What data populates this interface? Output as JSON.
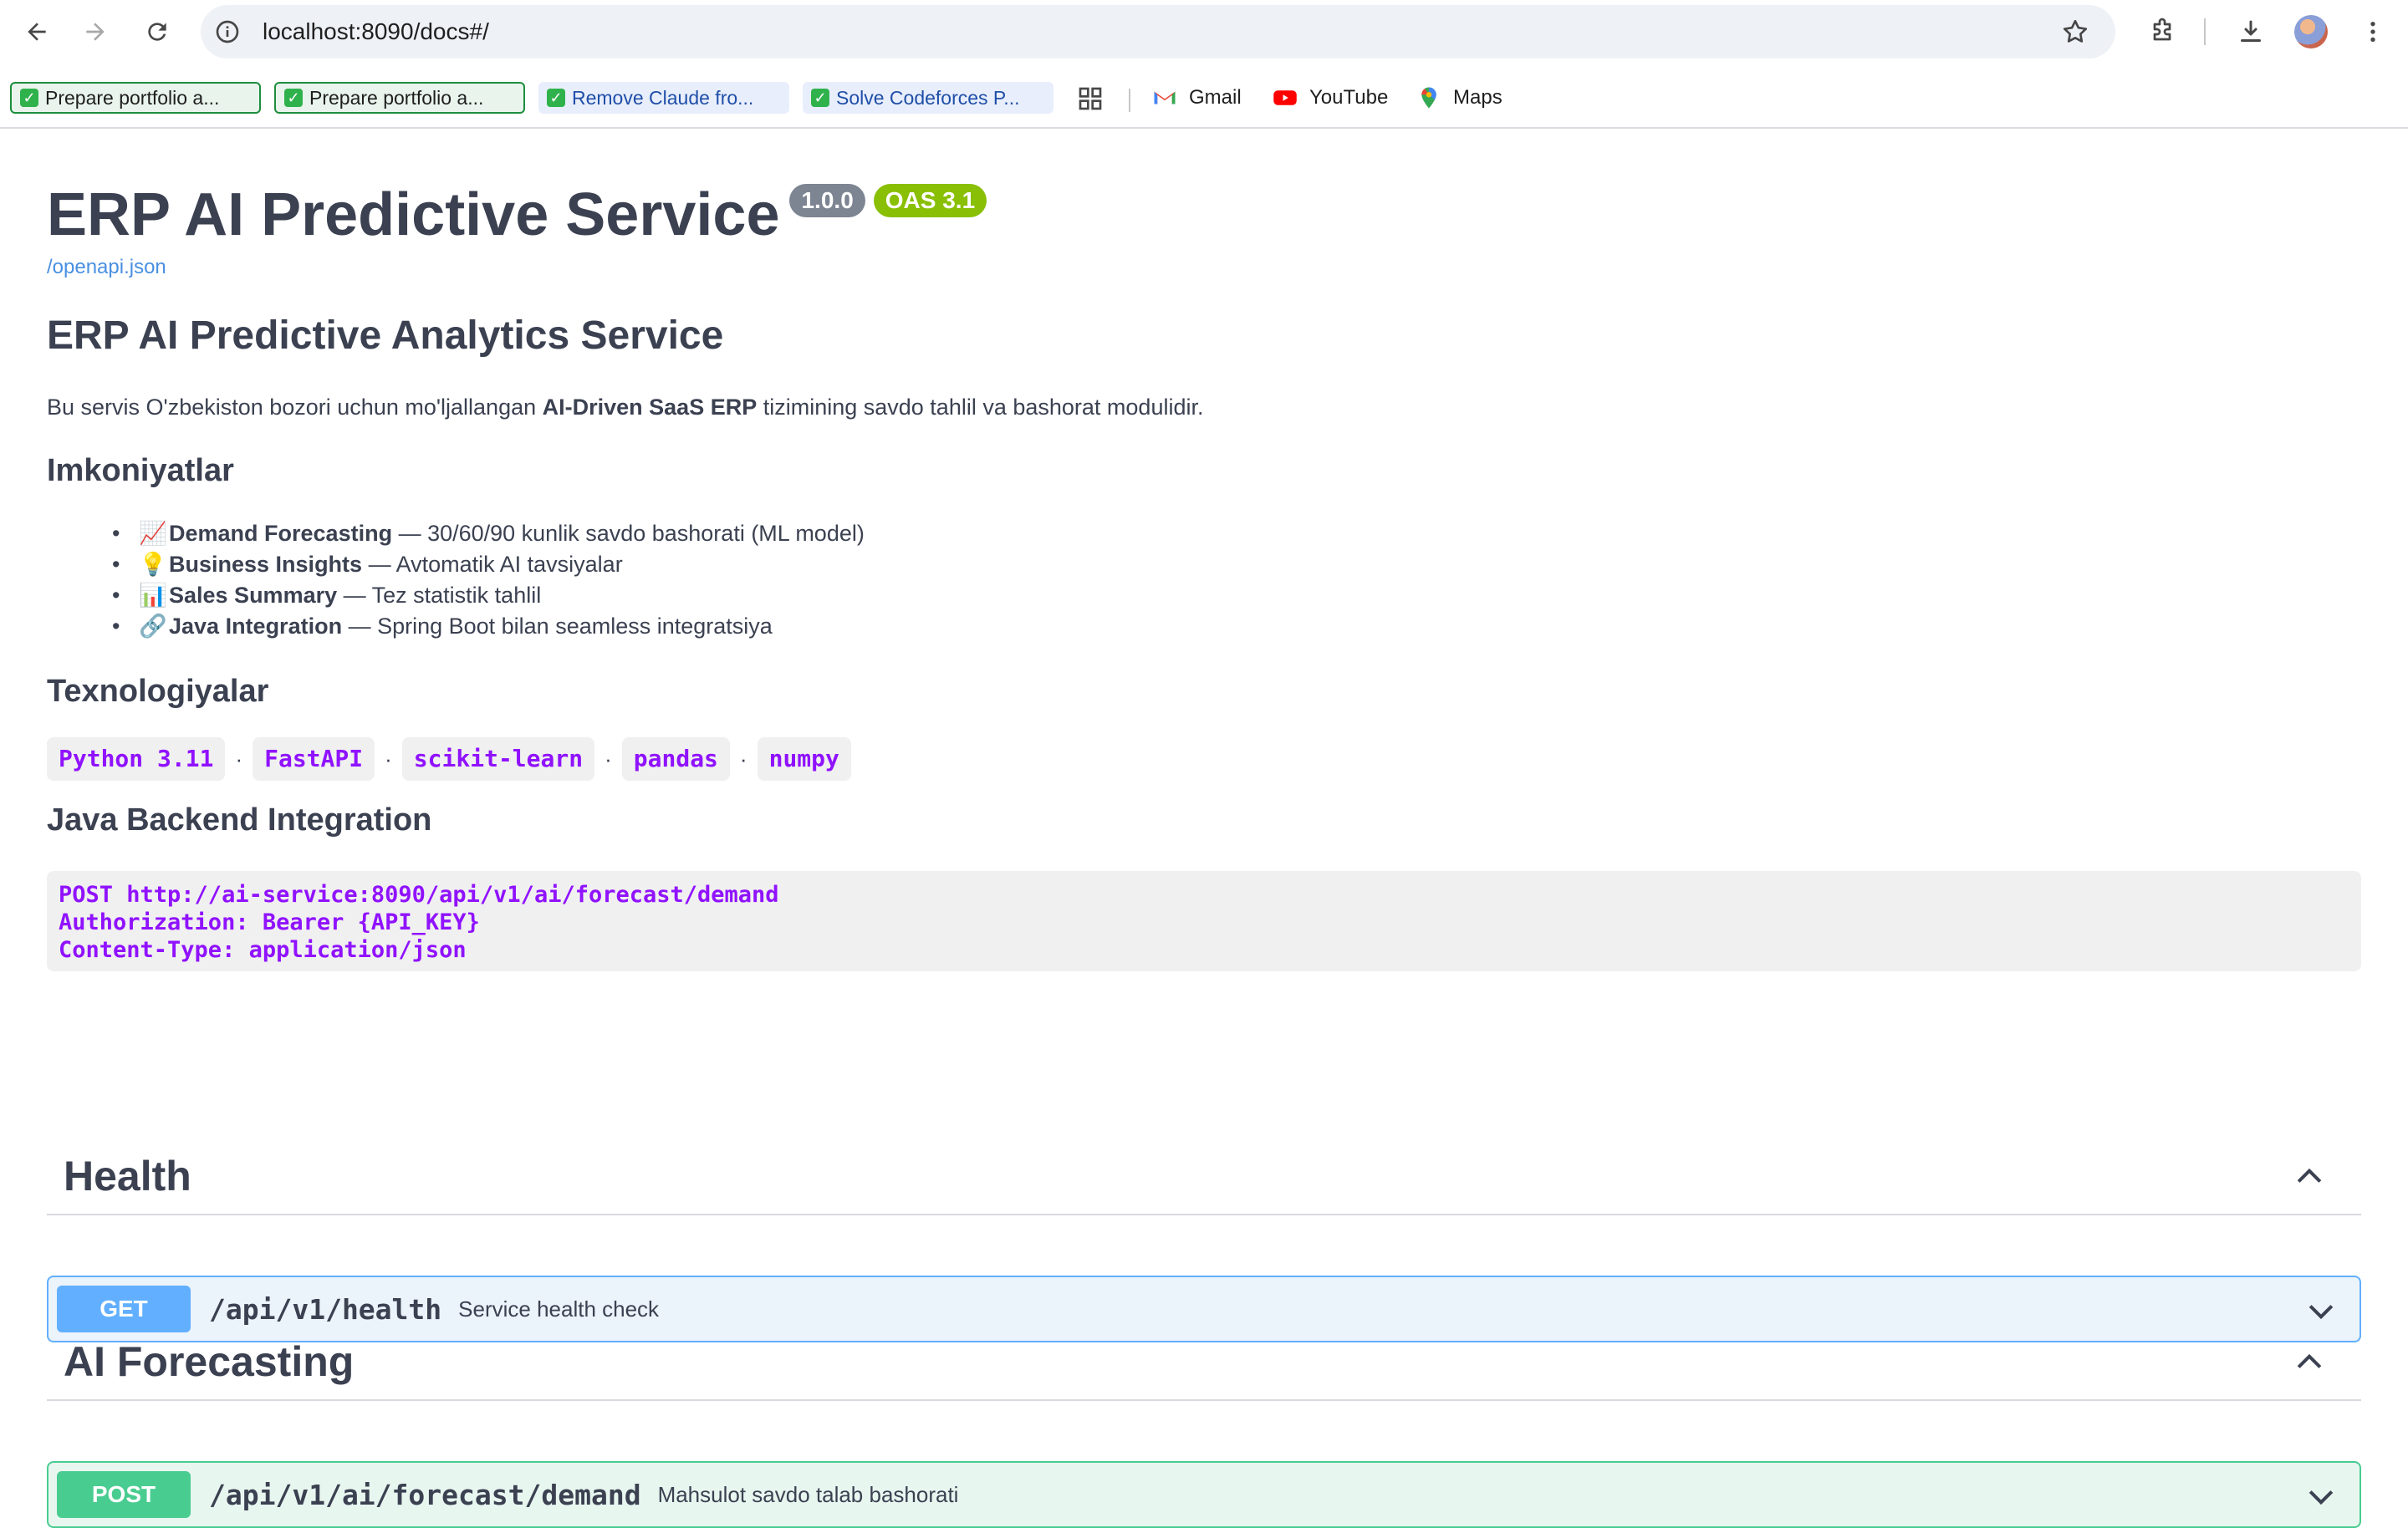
{
  "browser": {
    "url": "localhost:8090/docs#/",
    "bookmarks": [
      {
        "label": "Prepare portfolio a..."
      },
      {
        "label": "Prepare portfolio a..."
      },
      {
        "label": "Remove Claude fro..."
      },
      {
        "label": "Solve Codeforces P..."
      }
    ],
    "links": [
      {
        "label": "Gmail"
      },
      {
        "label": "YouTube"
      },
      {
        "label": "Maps"
      }
    ]
  },
  "info": {
    "title": "ERP AI Predictive Service",
    "version": "1.0.0",
    "oas": "OAS 3.1",
    "spec_link": "/openapi.json"
  },
  "description": {
    "heading": "ERP AI Predictive Analytics Service",
    "intro_before": "Bu servis O'zbekiston bozori uchun mo'ljallangan ",
    "intro_bold": "AI-Driven SaaS ERP",
    "intro_after": " tizimining savdo tahlil va bashorat modulidir.",
    "features_heading": "Imkoniyatlar",
    "features": [
      {
        "emoji": "📈",
        "name": "Demand Forecasting",
        "text": " — 30/60/90 kunlik savdo bashorati (ML model)"
      },
      {
        "emoji": "💡",
        "name": "Business Insights",
        "text": " — Avtomatik AI tavsiyalar"
      },
      {
        "emoji": "📊",
        "name": "Sales Summary",
        "text": " — Tez statistik tahlil"
      },
      {
        "emoji": "🔗",
        "name": "Java Integration",
        "text": " — Spring Boot bilan seamless integratsiya"
      }
    ],
    "tech_heading": "Texnologiyalar",
    "techs": [
      "Python 3.11",
      "FastAPI",
      "scikit-learn",
      "pandas",
      "numpy"
    ],
    "separator": "·",
    "java_heading": "Java Backend Integration",
    "code_lines": [
      "POST http://ai-service:8090/api/v1/ai/forecast/demand",
      "Authorization: Bearer {API_KEY}",
      "Content-Type: application/json"
    ]
  },
  "tags": [
    {
      "name": "Health",
      "operation": {
        "method": "GET",
        "path": "/api/v1/health",
        "summary": "Service health check"
      }
    },
    {
      "name": "AI Forecasting",
      "operation": {
        "method": "POST",
        "path": "/api/v1/ai/forecast/demand",
        "summary": "Mahsulot savdo talab bashorati"
      }
    }
  ],
  "colors": {
    "get": "#61affe",
    "post": "#49cc90",
    "code": "#9012fe",
    "badge_version": "#7d8492",
    "badge_oas": "#89bf04"
  }
}
